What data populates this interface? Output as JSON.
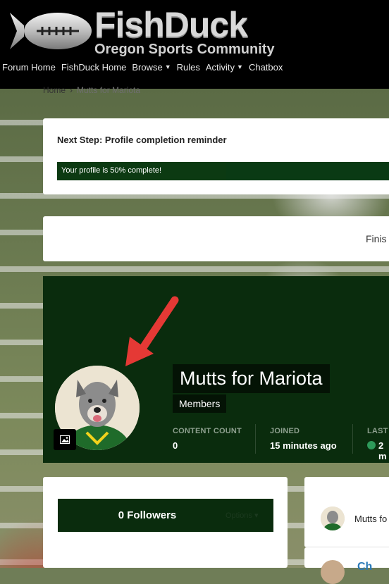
{
  "site": {
    "title": "FishDuck",
    "subtitle": "Oregon Sports Community",
    "nav": [
      "Forum Home",
      "FishDuck Home",
      "Browse",
      "Rules",
      "Activity",
      "Chatbox"
    ]
  },
  "breadcrumb": {
    "home": "Home",
    "separator": "›",
    "current": "Mutts for Mariota"
  },
  "reminder": {
    "title": "Next Step: Profile completion reminder",
    "progress_text": "Your profile is 50% complete!",
    "progress_fraction": 0.5
  },
  "finish": {
    "label": "Finis"
  },
  "profile": {
    "name": "Mutts for Mariota",
    "group": "Members",
    "stats": [
      {
        "label": "CONTENT COUNT",
        "value": "0"
      },
      {
        "label": "JOINED",
        "value": "15 minutes ago"
      },
      {
        "label": "LAST",
        "value": "2 m"
      }
    ]
  },
  "followers": {
    "title": "0 Followers",
    "options": "Options"
  },
  "sidebar": {
    "user1": "Mutts fo",
    "user2": "Ch"
  },
  "colors": {
    "brand_green": "#0a2c0d",
    "header": "#000000",
    "online": "#2e9a5a"
  }
}
